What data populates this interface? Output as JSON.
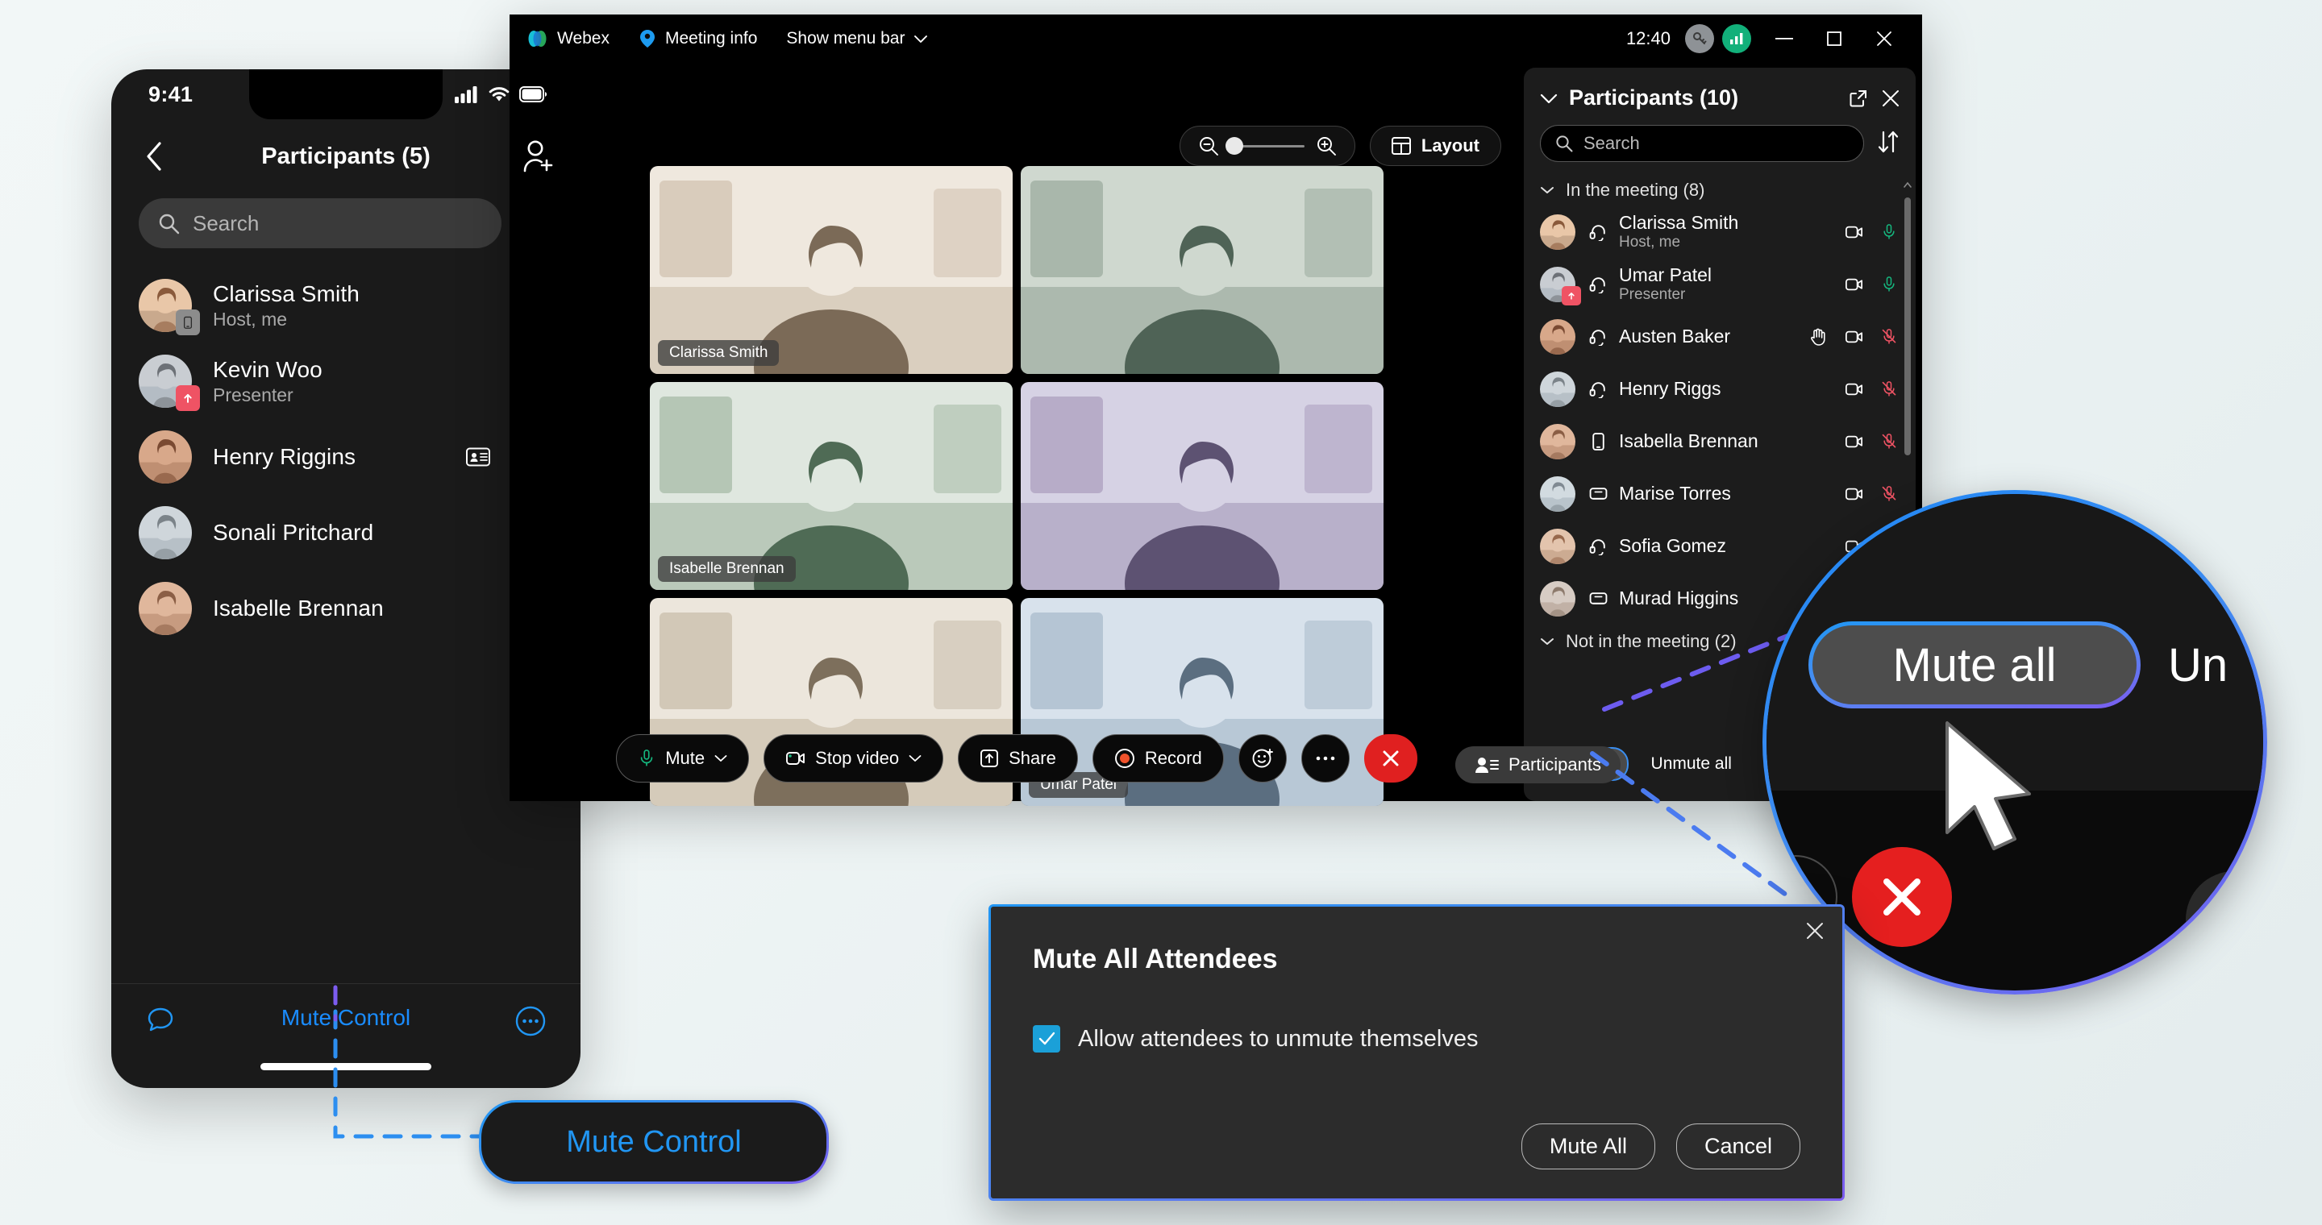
{
  "phone": {
    "status": {
      "time": "9:41",
      "icons": [
        "cellular-signal-icon",
        "wifi-icon",
        "battery-icon"
      ]
    },
    "header": {
      "back_icon": "chevron-left-icon",
      "title": "Participants (5)",
      "add_icon": "add-person-icon"
    },
    "search": {
      "placeholder": "Search",
      "icon": "search-icon",
      "sort_icon": "sort-icon"
    },
    "participants": [
      {
        "name": "Clarissa Smith",
        "role": "Host, me",
        "badge": "mobile-device-icon",
        "mic": "muted",
        "extra": ""
      },
      {
        "name": "Kevin Woo",
        "role": "Presenter",
        "badge": "share-screen-icon",
        "mic": "unmuted",
        "extra": ""
      },
      {
        "name": "Henry Riggins",
        "role": "",
        "badge": "",
        "mic": "unmuted",
        "extra": "contact-card-icon"
      },
      {
        "name": "Sonali Pritchard",
        "role": "",
        "badge": "",
        "mic": "unmuted",
        "extra": ""
      },
      {
        "name": "Isabelle Brennan",
        "role": "",
        "badge": "",
        "mic": "unmuted",
        "extra": ""
      }
    ],
    "bottom": {
      "chat_icon": "chat-bubble-icon",
      "label": "Mute Control",
      "more_icon": "more-circle-icon"
    }
  },
  "webex": {
    "titlebar": {
      "brand": "Webex",
      "brand_icon": "webex-logo-icon",
      "meeting_info": "Meeting info",
      "meeting_info_icon": "meeting-info-icon",
      "menu_bar": "Show menu bar",
      "menu_bar_icon": "chevron-down-icon",
      "clock": "12:40",
      "badge_gray_icon": "key-icon",
      "badge_green_icon": "network-bars-icon",
      "minimize_icon": "minimize-icon",
      "maximize_icon": "maximize-icon",
      "close_icon": "close-icon"
    },
    "stage": {
      "zoom": {
        "out_icon": "zoom-out-icon",
        "in_icon": "zoom-in-icon"
      },
      "layout": {
        "label": "Layout",
        "icon": "layout-grid-icon"
      },
      "tiles": [
        {
          "name": "Clarissa Smith",
          "show_label": true
        },
        {
          "name": "",
          "show_label": false
        },
        {
          "name": "Isabelle Brennan",
          "show_label": true
        },
        {
          "name": "",
          "show_label": false
        },
        {
          "name": "",
          "show_label": false
        },
        {
          "name": "Umar Patel",
          "show_label": true
        }
      ]
    },
    "controls": [
      {
        "label": "Mute",
        "icon": "microphone-icon",
        "caret": true,
        "type": "normal"
      },
      {
        "label": "Stop video",
        "icon": "camera-icon",
        "caret": true,
        "type": "normal"
      },
      {
        "label": "Share",
        "icon": "share-icon",
        "caret": false,
        "type": "normal"
      },
      {
        "label": "Record",
        "icon": "record-icon",
        "caret": false,
        "type": "normal"
      },
      {
        "label": "",
        "icon": "reactions-icon",
        "caret": false,
        "type": "round"
      },
      {
        "label": "",
        "icon": "more-icon",
        "caret": false,
        "type": "round"
      },
      {
        "label": "",
        "icon": "leave-icon",
        "caret": false,
        "type": "leave"
      }
    ],
    "participants_button": {
      "label": "Participants",
      "icon": "participants-icon"
    },
    "panel": {
      "collapse_icon": "chevron-down-icon",
      "title": "Participants (10)",
      "popout_icon": "popout-icon",
      "close_icon": "close-icon",
      "search": {
        "placeholder": "Search",
        "icon": "search-icon",
        "sort_icon": "sort-icon"
      },
      "sections": [
        {
          "label": "In the meeting (8)"
        },
        {
          "label": "Not in the meeting (2)"
        }
      ],
      "rows": [
        {
          "name": "Clarissa Smith",
          "role": "Host, me",
          "device": "headset-icon",
          "badge": "",
          "hand": false,
          "video": "video-icon",
          "mic": "unmuted"
        },
        {
          "name": "Umar Patel",
          "role": "Presenter",
          "device": "headset-icon",
          "badge": "share-screen-icon",
          "hand": false,
          "video": "video-icon",
          "mic": "unmuted"
        },
        {
          "name": "Austen Baker",
          "role": "",
          "device": "headset-icon",
          "badge": "",
          "hand": true,
          "video": "video-icon",
          "mic": "muted"
        },
        {
          "name": "Henry Riggs",
          "role": "",
          "device": "headset-icon",
          "badge": "",
          "hand": false,
          "video": "video-icon",
          "mic": "muted"
        },
        {
          "name": "Isabella Brennan",
          "role": "",
          "device": "mobile-device-icon",
          "badge": "",
          "hand": false,
          "video": "video-icon",
          "mic": "muted"
        },
        {
          "name": "Marise Torres",
          "role": "",
          "device": "desk-device-icon",
          "badge": "",
          "hand": false,
          "video": "video-icon",
          "mic": "muted"
        },
        {
          "name": "Sofia Gomez",
          "role": "",
          "device": "headset-icon",
          "badge": "",
          "hand": false,
          "video": "video-icon",
          "mic": "unmuted"
        },
        {
          "name": "Murad Higgins",
          "role": "",
          "device": "desk-device-icon",
          "badge": "",
          "hand": false,
          "video": "video-icon",
          "mic": "none"
        }
      ],
      "footer": {
        "mute_all": "Mute all",
        "unmute_all": "Unmute all"
      }
    }
  },
  "dialog": {
    "title": "Mute All Attendees",
    "close_icon": "close-icon",
    "checkbox": {
      "label": "Allow attendees to unmute themselves",
      "checked": true
    },
    "buttons": {
      "primary": "Mute All",
      "secondary": "Cancel"
    }
  },
  "callouts": {
    "mute_control": "Mute Control",
    "magnifier": {
      "mute_all": "Mute all",
      "unmute_all_partial": "Un"
    }
  },
  "colors": {
    "accent_blue": "#2196f3",
    "accent_purple": "#7c5cf0",
    "mic_green": "#15b87f",
    "mic_red": "#ef5364",
    "leave_red": "#e02020",
    "checkbox_blue": "#1ba0d8"
  }
}
